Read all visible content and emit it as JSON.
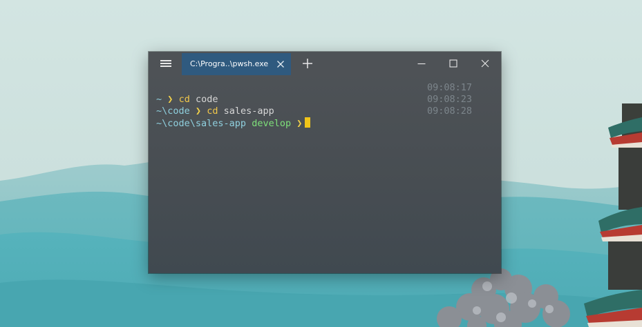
{
  "window": {
    "tab_title": "C:\\Progra..\\pwsh.exe"
  },
  "icons": {
    "menu": "hamburger-menu-icon",
    "tab_close": "close-icon",
    "new_tab": "plus-icon",
    "minimize": "minimize-icon",
    "maximize": "maximize-icon",
    "close": "close-icon"
  },
  "terminal": {
    "lines": [
      {
        "path": "~",
        "arrow": "❯",
        "cmd": "cd",
        "arg": "code",
        "time": "09:08:17"
      },
      {
        "path": "~\\code",
        "arrow": "❯",
        "cmd": "cd",
        "arg": "sales-app",
        "time": "09:08:23"
      },
      {
        "path": "~\\code\\sales-app",
        "branch_icon": "",
        "branch": "develop",
        "arrow": "❯",
        "time": "09:08:28"
      }
    ]
  },
  "colors": {
    "tab_active": "#2f5a7f",
    "path": "#8fd0de",
    "prompt_arrow": "#f2d14a",
    "command": "#f2c84a",
    "branch": "#7ee07a",
    "cursor": "#f0c419",
    "timestamp": "#7c858b"
  }
}
